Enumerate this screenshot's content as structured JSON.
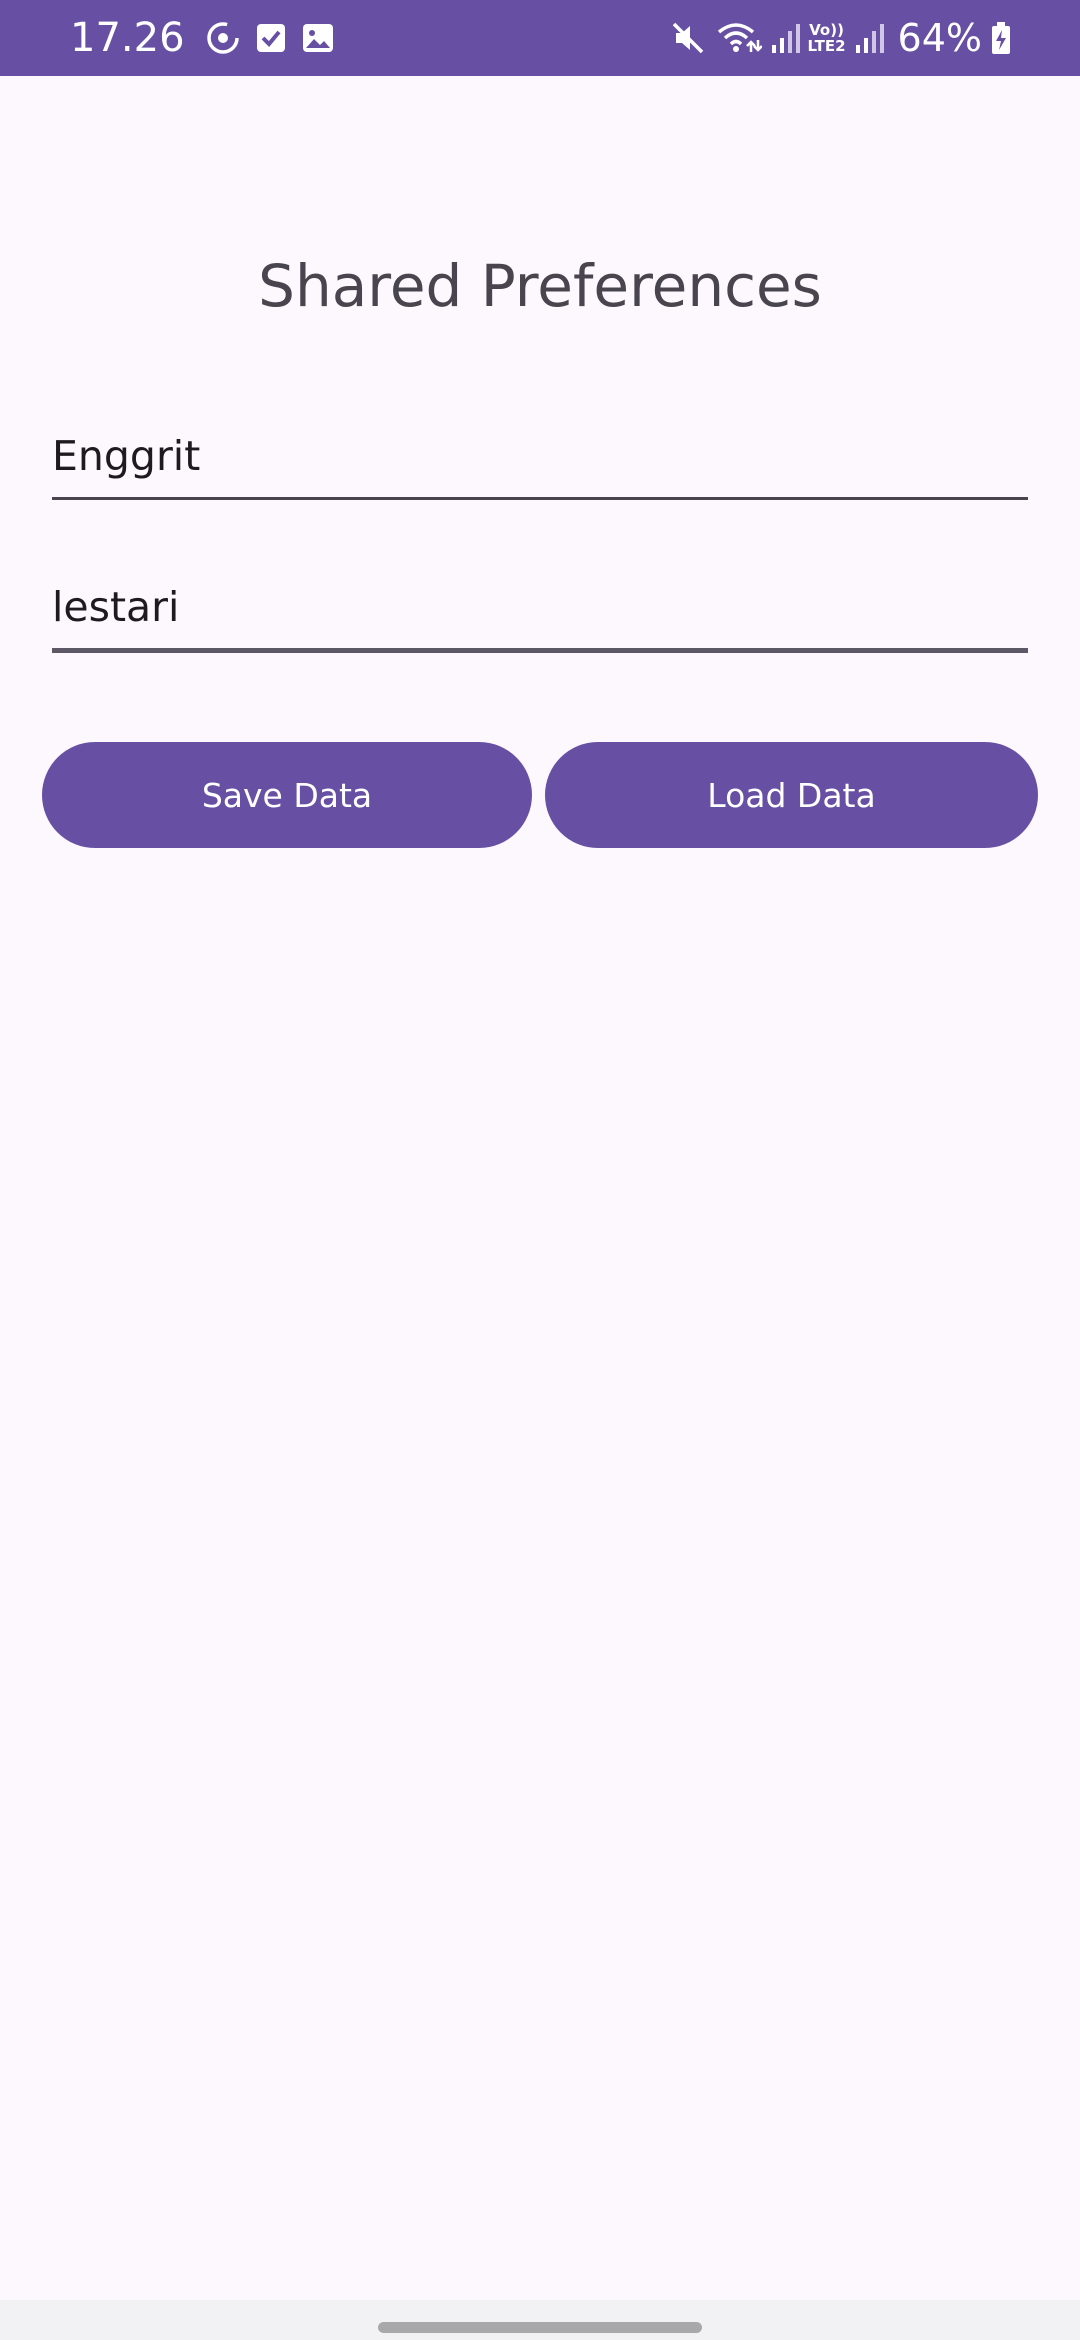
{
  "status_bar": {
    "time": "17.26",
    "battery": "64%",
    "network_label_top": "Vo))",
    "network_label_bottom": "LTE2",
    "left_icons": [
      "sync-icon",
      "task-check-icon",
      "gallery-icon"
    ],
    "right_icons": [
      "mute-icon",
      "wifi-icon",
      "signal-icon",
      "volte-label",
      "signal-icon",
      "battery-charging-icon"
    ],
    "background_color": "#6750a4"
  },
  "app": {
    "title": "Shared Preferences",
    "background_color": "#fdf8fd",
    "accent_color": "#6750a4"
  },
  "form": {
    "field1_value": "Enggrit",
    "field2_value": "lestari"
  },
  "buttons": {
    "save_label": "Save Data",
    "load_label": "Load Data"
  }
}
